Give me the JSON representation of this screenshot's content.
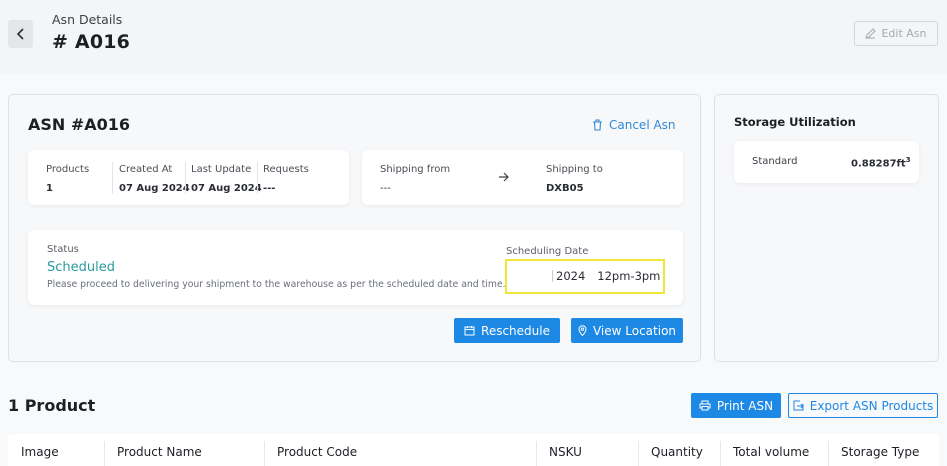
{
  "header": {
    "breadcrumb": "Asn Details",
    "title": "# A016",
    "edit_label": "Edit Asn"
  },
  "asn": {
    "title": "ASN #A016",
    "cancel_label": "Cancel Asn",
    "products_label": "Products",
    "products_value": "1",
    "created_label": "Created At",
    "created_value": "07 Aug 2024",
    "updated_label": "Last Update",
    "updated_value": "07 Aug 2024",
    "requests_label": "Requests",
    "requests_value": "---",
    "shipping_from_label": "Shipping from",
    "shipping_from_value": "---",
    "shipping_to_label": "Shipping to",
    "shipping_to_value": "DXB05",
    "status_label": "Status",
    "status_value": "Scheduled",
    "status_message": "Please proceed to delivering your shipment to the warehouse as per the scheduled date and time.",
    "scheduling_label": "Scheduling Date",
    "scheduling_year": "2024",
    "scheduling_time": "12pm-3pm",
    "reschedule_label": "Reschedule",
    "view_location_label": "View Location"
  },
  "storage": {
    "title": "Storage Utilization",
    "type_label": "Standard",
    "value": "0.88287ft",
    "unit_exp": "3"
  },
  "products": {
    "title": "1 Product",
    "print_label": "Print ASN",
    "export_label": "Export ASN Products",
    "columns": [
      "Image",
      "Product Name",
      "Product Code",
      "NSKU",
      "Quantity",
      "Total volume",
      "Storage Type"
    ]
  },
  "colors": {
    "accent": "#1e88e5",
    "status": "#2a9aa0",
    "highlight": "#f0e63a"
  }
}
